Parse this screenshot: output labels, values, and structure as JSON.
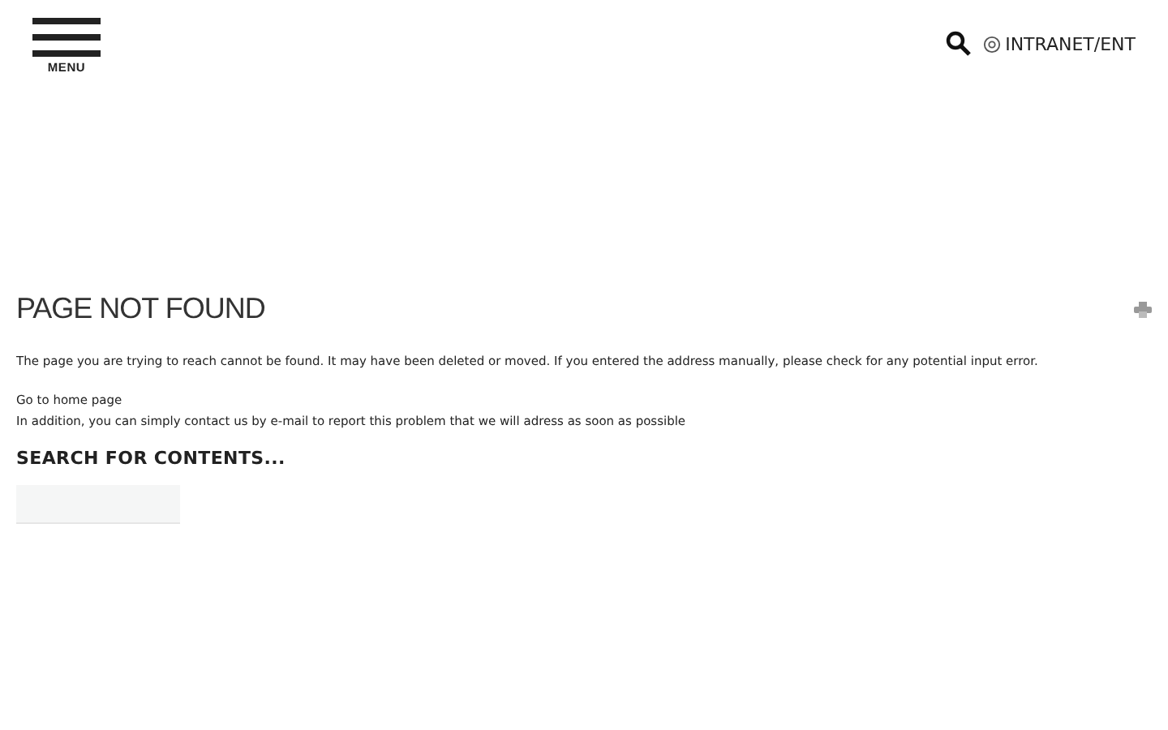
{
  "header": {
    "menu_label": "MENU",
    "intranet_link": "INTRANET/ENT"
  },
  "title": "PAGE NOT FOUND",
  "message": "The page you are trying to reach cannot be found. It may have been deleted or moved. If you entered the address manually, please check for any potential input error.",
  "home_link": "Go to home page",
  "contact_text": "In addition, you can simply contact us by e-mail to report this problem that we will adress as soon as possible",
  "search_heading": "SEARCH FOR CONTENTS..."
}
